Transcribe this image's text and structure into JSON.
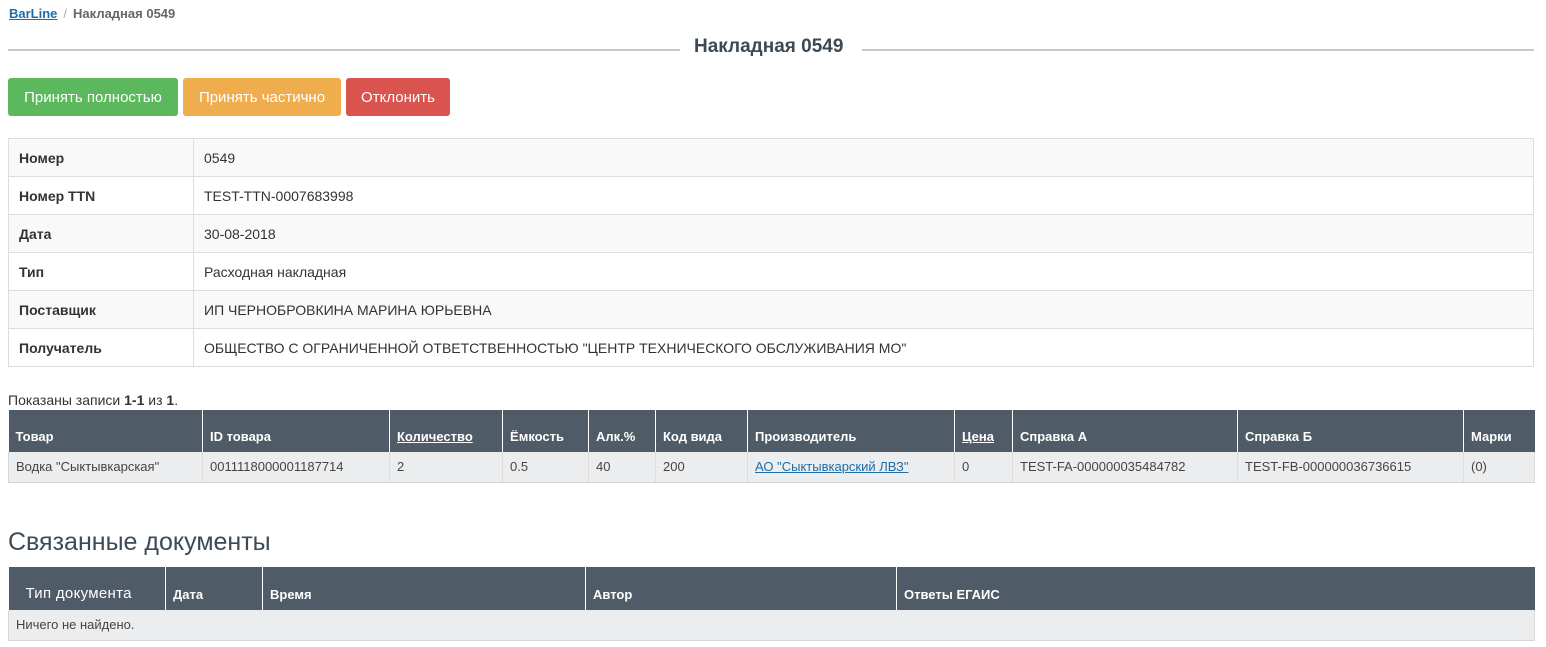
{
  "breadcrumb": {
    "root": "BarLine",
    "separator": "/",
    "current": "Накладная 0549"
  },
  "page_title": "Накладная 0549",
  "actions": {
    "accept_full": "Принять полностью",
    "accept_partial": "Принять частично",
    "reject": "Отклонить",
    "colors": {
      "accept_full": "#5cb85c",
      "accept_partial": "#f0ad4e",
      "reject": "#d9534f"
    }
  },
  "details": [
    {
      "label": "Номер",
      "value": "0549"
    },
    {
      "label": "Номер TTN",
      "value": "TEST-TTN-0007683998"
    },
    {
      "label": "Дата",
      "value": "30-08-2018"
    },
    {
      "label": "Тип",
      "value": "Расходная накладная"
    },
    {
      "label": "Поставщик",
      "value": "ИП ЧЕРНОБРОВКИНА МАРИНА ЮРЬЕВНА"
    },
    {
      "label": "Получатель",
      "value": "ОБЩЕСТВО С ОГРАНИЧЕННОЙ ОТВЕТСТВЕННОСТЬЮ \"ЦЕНТР ТЕХНИЧЕСКОГО ОБСЛУЖИВАНИЯ МО\""
    }
  ],
  "summary": {
    "prefix": "Показаны записи ",
    "range": "1-1",
    "middle": " из ",
    "total": "1",
    "suffix": "."
  },
  "items_table": {
    "columns": [
      "Товар",
      "ID товара",
      "Количество",
      "Ёмкость",
      "Алк.%",
      "Код вида",
      "Производитель",
      "Цена",
      "Справка А",
      "Справка Б",
      "Марки"
    ],
    "rows": [
      {
        "product": "Водка \"Сыктывкарская\"",
        "product_id": "0011118000001187714",
        "quantity": "2",
        "capacity": "0.5",
        "alcohol": "40",
        "kind_code": "200",
        "producer": "АО \"Сыктывкарский ЛВЗ\"",
        "price": "0",
        "cert_a": "TEST-FA-000000035484782",
        "cert_b": "TEST-FB-000000036736615",
        "marks": "(0)"
      }
    ]
  },
  "related": {
    "title": "Связанные документы",
    "columns": [
      "Тип документа",
      "Дата",
      "Время",
      "Автор",
      "Ответы ЕГАИС"
    ],
    "empty": "Ничего не найдено."
  }
}
